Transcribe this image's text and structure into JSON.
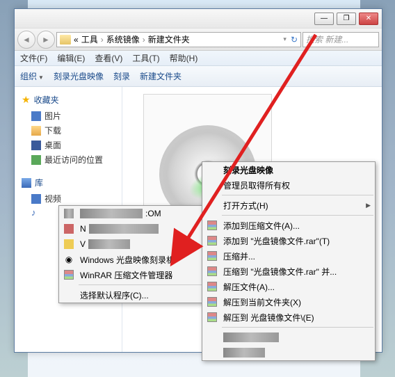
{
  "titlebar": {
    "min": "—",
    "max": "❐",
    "close": "✕"
  },
  "nav": {
    "back": "◄",
    "fwd": "►",
    "refresh": "↻"
  },
  "breadcrumb": {
    "lvl1": "工具",
    "lvl2": "系统镜像",
    "lvl3": "新建文件夹",
    "sep": "›",
    "drop": "▾"
  },
  "search": {
    "placeholder": "搜索 新建..."
  },
  "menubar": {
    "file": "文件(F)",
    "edit": "编辑(E)",
    "view": "查看(V)",
    "tools": "工具(T)",
    "help": "帮助(H)"
  },
  "toolbar": {
    "organize": "组织",
    "burn": "刻录光盘映像",
    "burn2": "刻录",
    "newfolder": "新建文件夹"
  },
  "sidebar": {
    "favorites": "收藏夹",
    "fav_items": [
      "图片",
      "下载",
      "桌面",
      "最近访问的位置"
    ],
    "libraries": "库",
    "lib_items": [
      "视频"
    ]
  },
  "submenu1": {
    "items": [
      {
        "label": ":OM",
        "blur": true
      },
      {
        "label": "N",
        "blur": true
      },
      {
        "label": "V",
        "blur": true
      },
      {
        "label": "Windows 光盘映像刻录机"
      },
      {
        "label": "WinRAR 压缩文件管理器"
      }
    ],
    "choose": "选择默认程序(C)..."
  },
  "submenu2": {
    "burn_bold": "刻录光盘映像",
    "admin": "管理员取得所有权",
    "open_with": "打开方式(H)",
    "rar": [
      "添加到压缩文件(A)...",
      "添加到 \"光盘镜像文件.rar\"(T)",
      "压缩并...",
      "压缩到 \"光盘镜像文件.rar\" 并...",
      "解压文件(A)...",
      "解压到当前文件夹(X)",
      "解压到 光盘镜像文件\\(E)"
    ]
  }
}
